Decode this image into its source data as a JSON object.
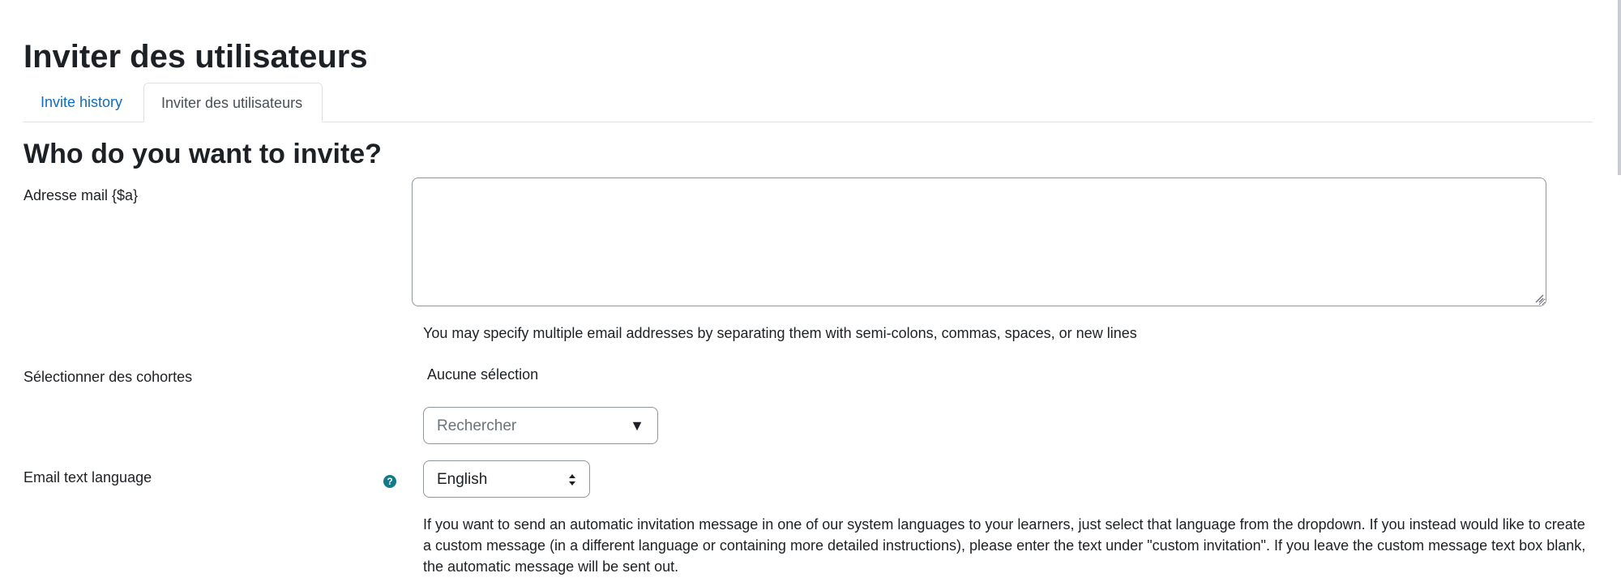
{
  "page": {
    "title": "Inviter des utilisateurs"
  },
  "tabs": [
    {
      "label": "Invite history",
      "active": false
    },
    {
      "label": "Inviter des utilisateurs",
      "active": true
    }
  ],
  "form": {
    "section_heading": "Who do you want to invite?",
    "email": {
      "label": "Adresse mail {$a}",
      "value": "",
      "help": "You may specify multiple email addresses by separating them with semi-colons, commas, spaces, or new lines"
    },
    "cohorts": {
      "label": "Sélectionner des cohortes",
      "selection": "Aucune sélection",
      "search_placeholder": "Rechercher",
      "arrow": "▼"
    },
    "language": {
      "label": "Email text language",
      "help_icon": "question-circle-icon",
      "selected": "English",
      "help": "If you want to send an automatic invitation message in one of our system languages to your learners, just select that language from the dropdown. If you instead would like to create a custom message (in a different language or containing more detailed instructions), please enter the text under \"custom invitation\". If you leave the custom message text box blank, the automatic message will be sent out."
    }
  },
  "colors": {
    "link": "#0f6cbf",
    "help_icon": "#117a8b",
    "text": "#1d2125",
    "border": "#8f959e"
  }
}
